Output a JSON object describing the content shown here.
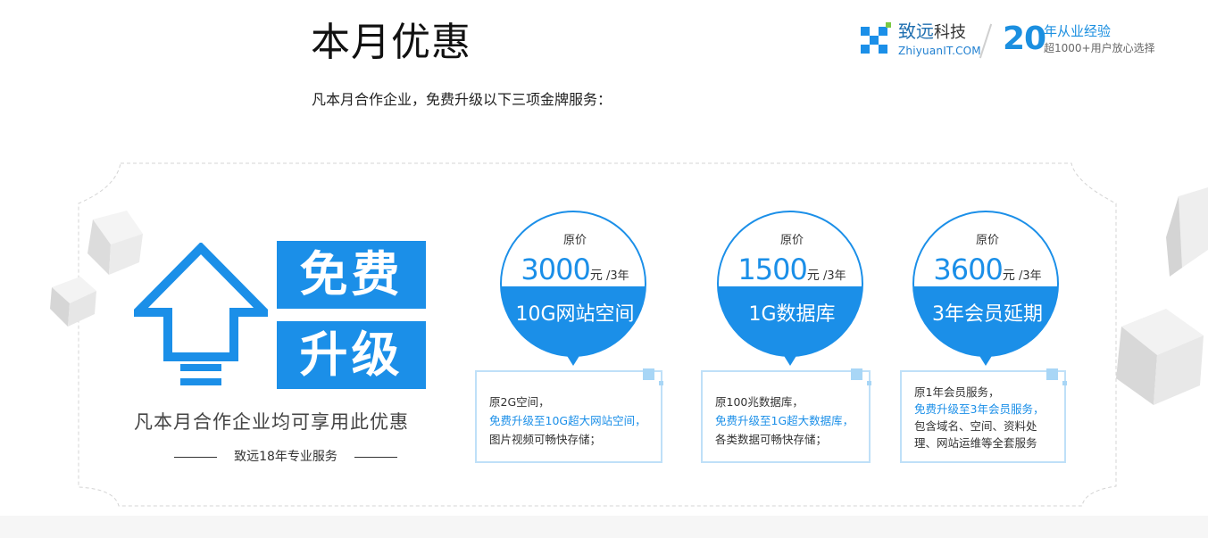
{
  "header": {
    "title": "本月优惠",
    "subtitle": "凡本月合作企业，免费升级以下三项金牌服务："
  },
  "logo": {
    "brand_cn": "致远",
    "brand_tech": "科技",
    "domain": "ZhiyuanIT.COM",
    "years_num": "20",
    "years_text": "年从业经验",
    "years_sub": "超1000+用户放心选择"
  },
  "promo": {
    "line1": "免费",
    "line2": "升级",
    "tagline": "凡本月合作企业均可享用此优惠",
    "sign": "致远18年专业服务"
  },
  "offers": [
    {
      "orig_label": "原价",
      "price": "3000",
      "unit": "元",
      "per": " /3年",
      "service": "10G网站空间",
      "desc1": "原2G空间，",
      "desc2": "免费升级至10G超大网站空间，",
      "desc3": "图片视频可畅快存储；"
    },
    {
      "orig_label": "原价",
      "price": "1500",
      "unit": "元",
      "per": " /3年",
      "service": "1G数据库",
      "desc1": "原100兆数据库，",
      "desc2": "免费升级至1G超大数据库，",
      "desc3": "各类数据可畅快存储；"
    },
    {
      "orig_label": "原价",
      "price": "3600",
      "unit": "元",
      "per": " /3年",
      "service": "3年会员延期",
      "desc1": "原1年会员服务，",
      "desc2": "免费升级至3年会员服务，",
      "desc3": "包含域名、空间、资料处",
      "desc4": "理、网站运维等全套服务"
    }
  ],
  "colors": {
    "accent": "#1b8fe8",
    "light_accent": "#bfe0f8"
  }
}
